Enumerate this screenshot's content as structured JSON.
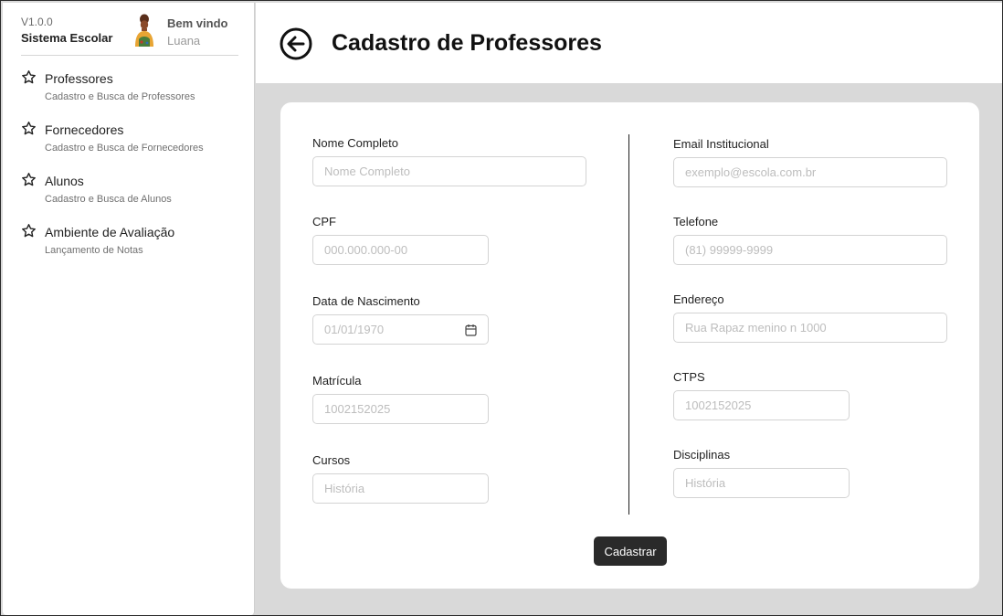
{
  "sidebar": {
    "version": "V1.0.0",
    "app_name": "Sistema Escolar",
    "welcome": "Bem vindo",
    "username": "Luana",
    "items": [
      {
        "icon": "star-icon",
        "label": "Professores",
        "sub": "Cadastro e Busca de Professores"
      },
      {
        "icon": "star-icon",
        "label": "Fornecedores",
        "sub": "Cadastro e Busca de Fornecedores"
      },
      {
        "icon": "star-icon",
        "label": "Alunos",
        "sub": "Cadastro e Busca de Alunos"
      },
      {
        "icon": "star-icon",
        "label": "Ambiente de Avaliação",
        "sub": "Lançamento de Notas"
      }
    ]
  },
  "header": {
    "back_icon": "arrow-left-circle-icon",
    "title": "Cadastro de Professores"
  },
  "form": {
    "left": [
      {
        "label": "Nome Completo",
        "placeholder": "Nome Completo"
      },
      {
        "label": "CPF",
        "placeholder": "000.000.000-00"
      },
      {
        "label": "Data de Nascimento",
        "placeholder": "01/01/1970"
      },
      {
        "label": "Matrícula",
        "placeholder": "1002152025"
      },
      {
        "label": "Cursos",
        "placeholder": "História"
      }
    ],
    "right": [
      {
        "label": "Email Institucional",
        "placeholder": "exemplo@escola.com.br"
      },
      {
        "label": "Telefone",
        "placeholder": "(81) 99999-9999"
      },
      {
        "label": "Endereço",
        "placeholder": "Rua Rapaz menino n 1000"
      },
      {
        "label": "CTPS",
        "placeholder": "1002152025"
      },
      {
        "label": "Disciplinas",
        "placeholder": "História"
      }
    ],
    "submit_label": "Cadastrar"
  },
  "colors": {
    "background": "#d9d9d9",
    "card": "#ffffff",
    "button": "#2a2a2a"
  }
}
